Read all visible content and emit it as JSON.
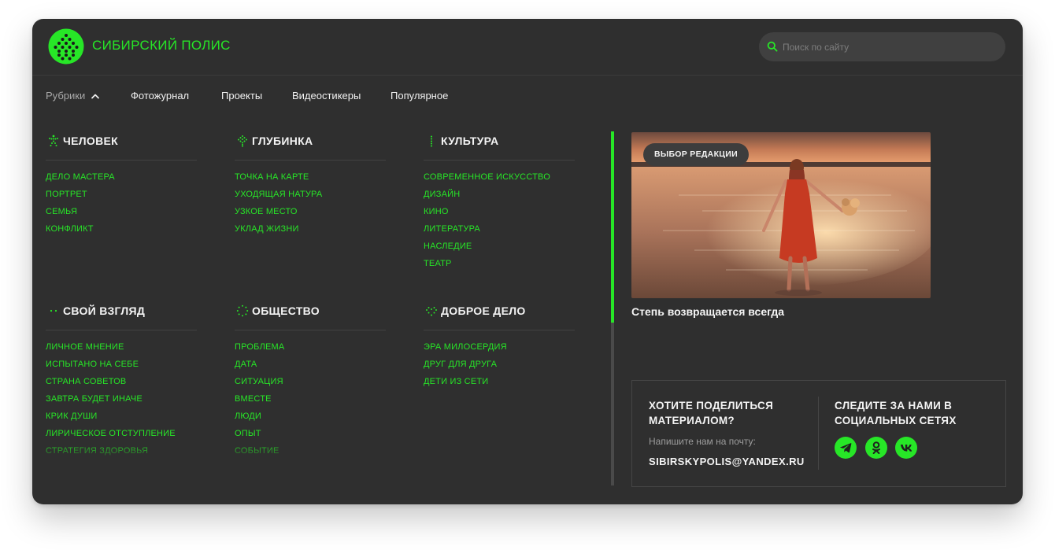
{
  "brand": {
    "name": "СИБИРСКИЙ ПОЛИС",
    "accent": "#27e627"
  },
  "search": {
    "placeholder": "Поиск по сайту"
  },
  "nav": {
    "rubriki": "Рубрики",
    "items": [
      "Фотожурнал",
      "Проекты",
      "Видеостикеры",
      "Популярное"
    ]
  },
  "sections": [
    {
      "title": "ЧЕЛОВЕК",
      "icon": "human-figure-icon",
      "links": [
        "ДЕЛО МАСТЕРА",
        "ПОРТРЕТ",
        "СЕМЬЯ",
        "КОНФЛИКТ"
      ]
    },
    {
      "title": "ГЛУБИНКА",
      "icon": "tree-icon",
      "links": [
        "ТОЧКА НА КАРТЕ",
        "УХОДЯЩАЯ НАТУРА",
        "УЗКОЕ МЕСТО",
        "УКЛАД ЖИЗНИ"
      ]
    },
    {
      "title": "КУЛЬТУРА",
      "icon": "dots-vertical-icon",
      "links": [
        "СОВРЕМЕННОЕ ИСКУССТВО",
        "ДИЗАЙН",
        "КИНО",
        "ЛИТЕРАТУРА",
        "НАСЛЕДИЕ",
        "ТЕАТР"
      ]
    },
    {
      "title": "СВОЙ ВЗГЛЯД",
      "icon": "eyes-dots-icon",
      "links": [
        "ЛИЧНОЕ МНЕНИЕ",
        "ИСПЫТАНО НА СЕБЕ",
        "СТРАНА СОВЕТОВ",
        "ЗАВТРА БУДЕТ ИНАЧЕ",
        "КРИК ДУШИ",
        "ЛИРИЧЕСКОЕ ОТСТУПЛЕНИЕ",
        "СТРАТЕГИЯ ЗДОРОВЬЯ"
      ]
    },
    {
      "title": "ОБЩЕСТВО",
      "icon": "circle-dots-icon",
      "links": [
        "ПРОБЛЕМА",
        "ДАТА",
        "СИТУАЦИЯ",
        "ВМЕСТЕ",
        "ЛЮДИ",
        "ОПЫТ",
        "СОБЫТИЕ"
      ]
    },
    {
      "title": "ДОБРОЕ ДЕЛО",
      "icon": "heart-dots-icon",
      "links": [
        "ЭРА МИЛОСЕРДИЯ",
        "ДРУГ ДЛЯ ДРУГА",
        "ДЕТИ ИЗ СЕТИ"
      ]
    }
  ],
  "feature": {
    "badge": "ВЫБОР РЕДАКЦИИ",
    "title": "Степь возвращается всегда"
  },
  "contact": {
    "share_title_1": "ХОТИТЕ ПОДЕЛИТЬСЯ",
    "share_title_2": "МАТЕРИАЛОМ?",
    "share_sub": "Напишите нам на почту:",
    "email": "SIBIRSKYPOLIS@YANDEX.RU",
    "follow_title_1": "СЛЕДИТЕ ЗА НАМИ В",
    "follow_title_2": "СОЦИАЛЬНЫХ СЕТЯХ",
    "socials": [
      "telegram-icon",
      "odnoklassniki-icon",
      "vk-icon"
    ]
  }
}
